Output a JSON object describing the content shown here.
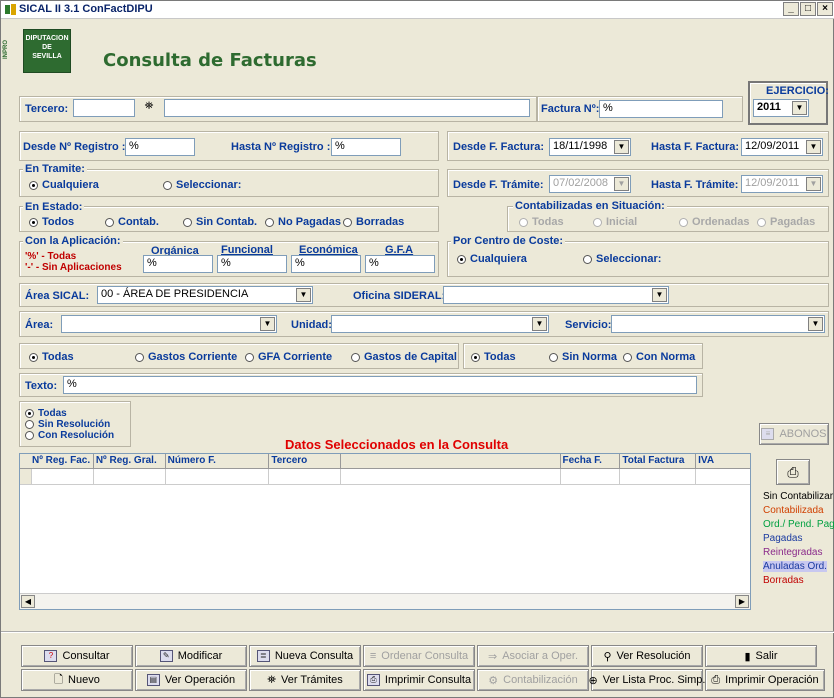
{
  "window": {
    "title": "SICAL II 3.1 ConFactDIPU",
    "min": "_",
    "max": "□",
    "close": "×"
  },
  "header": {
    "logo_line1": "DIPUTACION",
    "logo_line2": "DE",
    "logo_line3": "SEVILLA",
    "side_text": "INPRO",
    "title": "Consulta de Facturas"
  },
  "ejercicio": {
    "label": "EJERCICIO:",
    "value": "2011"
  },
  "tercero": {
    "label": "Tercero:",
    "code": "",
    "name": ""
  },
  "factura": {
    "label": "Factura Nº:",
    "value": "%"
  },
  "registro": {
    "desde_label": "Desde Nº Registro :",
    "desde_value": "%",
    "hasta_label": "Hasta Nº Registro :",
    "hasta_value": "%"
  },
  "fecha_factura": {
    "desde_label": "Desde F. Factura:",
    "desde_value": "18/11/1998",
    "hasta_label": "Hasta F. Factura:",
    "hasta_value": "12/09/2011"
  },
  "tramite": {
    "group": "En Tramite:",
    "opt1": "Cualquiera",
    "opt2": "Seleccionar:"
  },
  "fecha_tramite": {
    "desde_label": "Desde F. Trámite:",
    "desde_value": "07/02/2008",
    "hasta_label": "Hasta F. Trámite:",
    "hasta_value": "12/09/2011"
  },
  "estado": {
    "group": "En Estado:",
    "opts": [
      "Todos",
      "Contab.",
      "Sin Contab.",
      "No Pagadas",
      "Borradas"
    ]
  },
  "situacion": {
    "group": "Contabilizadas en Situación:",
    "opts": [
      "Todas",
      "Inicial",
      "Ordenadas",
      "Pagadas"
    ]
  },
  "aplicacion": {
    "group": "Con la Aplicación:",
    "note1": "'%' - Todas",
    "note2": "'-' - Sin Aplicaciones",
    "organica": "Orgánica",
    "funcional": "Funcional",
    "economica": "Económica",
    "gfa": "G.F.A",
    "v1": "%",
    "v2": "%",
    "v3": "%",
    "v4": "%"
  },
  "coste": {
    "group": "Por Centro de Coste:",
    "opt1": "Cualquiera",
    "opt2": "Seleccionar:"
  },
  "area_sical": {
    "label": "Área SICAL:",
    "value": "00 - ÁREA DE PRESIDENCIA",
    "oficina_label": "Oficina SIDERAL:",
    "oficina_value": ""
  },
  "area": {
    "label": "Área:",
    "unidad_label": "Unidad:",
    "servicio_label": "Servicio:"
  },
  "gastos": {
    "opts": [
      "Todas",
      "Gastos Corriente",
      "GFA Corriente",
      "Gastos de Capital"
    ],
    "norma": [
      "Todas",
      "Sin Norma",
      "Con Norma"
    ]
  },
  "texto": {
    "label": "Texto:",
    "value": "%"
  },
  "resolucion": {
    "opts": [
      "Todas",
      "Sin Resolución",
      "Con Resolución"
    ]
  },
  "grid": {
    "caption": "Datos Seleccionados en la Consulta",
    "columns": [
      "Nº Reg. Fac.",
      "Nº Reg. Gral.",
      "Número F.",
      "Tercero",
      "",
      "Fecha F.",
      "Total Factura",
      "IVA"
    ]
  },
  "abonos": "ABONOS",
  "legend": [
    {
      "text": "Sin Contabilizar",
      "color": "#000000",
      "bg": ""
    },
    {
      "text": "Contabilizada",
      "color": "#d04000",
      "bg": ""
    },
    {
      "text": "Ord./ Pend. Pag",
      "color": "#00a040",
      "bg": ""
    },
    {
      "text": "Pagadas",
      "color": "#1a3aa0",
      "bg": ""
    },
    {
      "text": "Reintegradas",
      "color": "#8a2a8a",
      "bg": ""
    },
    {
      "text": "Anuladas Ord.",
      "color": "#1a3aa0",
      "bg": "#c8c8f0"
    },
    {
      "text": "Borradas",
      "color": "#c00000",
      "bg": ""
    }
  ],
  "buttons_row1": [
    "Consultar",
    "Modificar",
    "Nueva Consulta",
    "Ordenar Consulta",
    "Asociar a Oper.",
    "Ver Resolución",
    "Salir"
  ],
  "buttons_row2": [
    "Nuevo",
    "Ver Operación",
    "Ver Trámites",
    "Imprimir Consulta",
    "Contabilización",
    "Ver Lista Proc. Simp.",
    "Imprimir Operación"
  ]
}
